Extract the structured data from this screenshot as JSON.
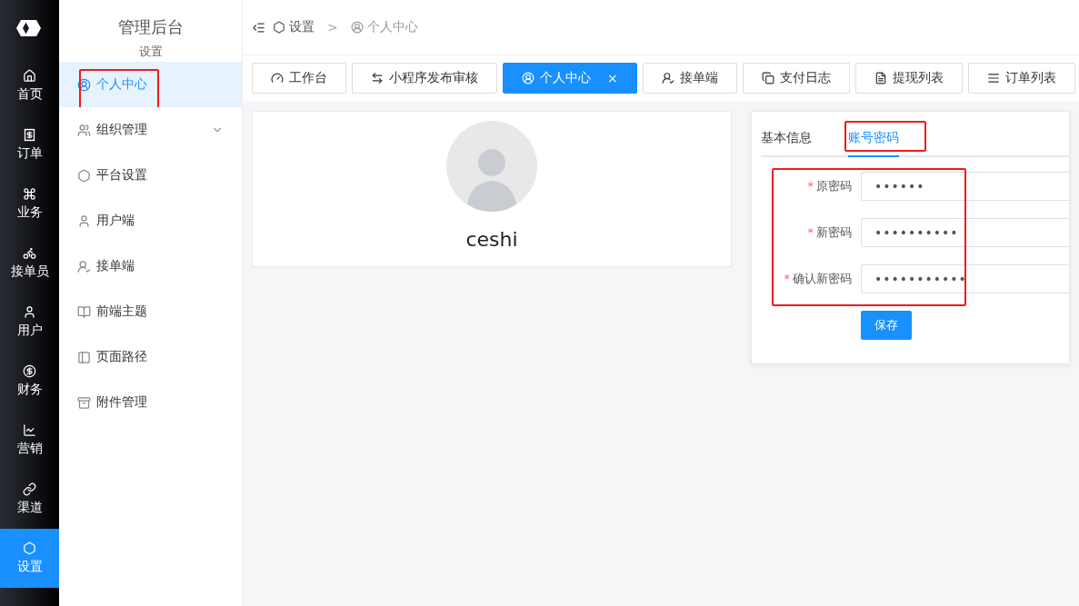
{
  "rail": {
    "items": [
      {
        "label": "首页",
        "selected": false
      },
      {
        "label": "订单",
        "selected": false
      },
      {
        "label": "业务",
        "selected": false
      },
      {
        "label": "接单员",
        "selected": false
      },
      {
        "label": "用户",
        "selected": false
      },
      {
        "label": "财务",
        "selected": false
      },
      {
        "label": "营销",
        "selected": false
      },
      {
        "label": "渠道",
        "selected": false
      },
      {
        "label": "设置",
        "selected": true
      }
    ]
  },
  "sidebar": {
    "title": "管理后台",
    "section": "设置",
    "items": [
      {
        "label": "个人中心",
        "selected": true,
        "highlighted": true
      },
      {
        "label": "组织管理",
        "selected": false,
        "highlighted": false,
        "expanded": false
      },
      {
        "label": "平台设置",
        "selected": false,
        "highlighted": false
      },
      {
        "label": "用户端",
        "selected": false,
        "highlighted": false
      },
      {
        "label": "接单端",
        "selected": false,
        "highlighted": false
      },
      {
        "label": "前端主题",
        "selected": false,
        "highlighted": false
      },
      {
        "label": "页面路径",
        "selected": false,
        "highlighted": false
      },
      {
        "label": "附件管理",
        "selected": false,
        "highlighted": false
      }
    ]
  },
  "breadcrumb": [
    "设置",
    "个人中心"
  ],
  "breadcrumb_separator": ">",
  "tabs": [
    {
      "label": "工作台",
      "selected": false
    },
    {
      "label": "小程序发布审核",
      "selected": false
    },
    {
      "label": "个人中心",
      "selected": true,
      "close": "×"
    },
    {
      "label": "接单端",
      "selected": false
    },
    {
      "label": "支付日志",
      "selected": false
    },
    {
      "label": "提现列表",
      "selected": false
    },
    {
      "label": "订单列表",
      "selected": false
    }
  ],
  "profile": {
    "username": "ceshi"
  },
  "account": {
    "tabs": [
      {
        "label": "基本信息",
        "selected": false,
        "highlighted": false
      },
      {
        "label": "账号密码",
        "selected": true,
        "highlighted": true
      }
    ],
    "form_highlighted": true,
    "fields": [
      {
        "label": "原密码",
        "required_mark": "*",
        "value": "••••••"
      },
      {
        "label": "新密码",
        "required_mark": "*",
        "value": "••••••••••"
      },
      {
        "label": "确认新密码",
        "required_mark": "*",
        "value": "•••••••••••"
      }
    ],
    "save_button": "保存"
  }
}
